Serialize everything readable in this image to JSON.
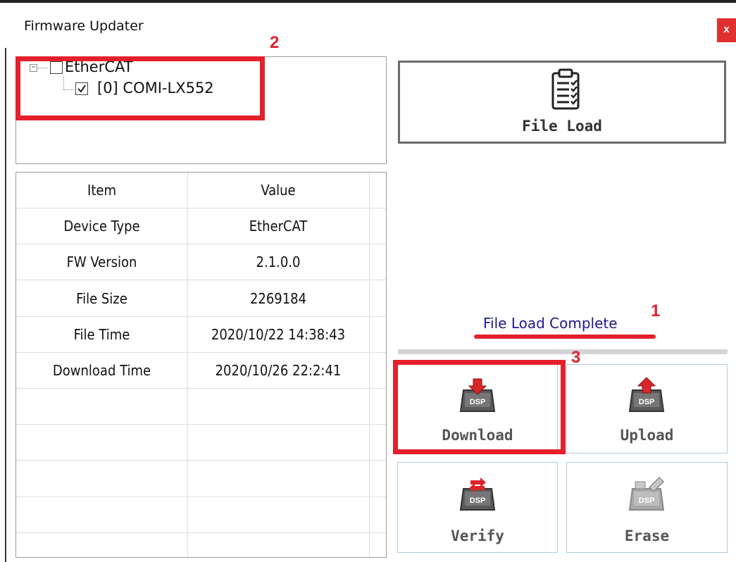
{
  "window": {
    "title": "Firmware Updater",
    "close_label": "x"
  },
  "tree": {
    "root": {
      "label": "EtherCAT",
      "checked": false,
      "expanded": true
    },
    "children": [
      {
        "label": "[0] COMI-LX552",
        "checked": true
      }
    ]
  },
  "table": {
    "headers": [
      "Item",
      "Value"
    ],
    "rows": [
      [
        "Device Type",
        "EtherCAT"
      ],
      [
        "FW Version",
        "2.1.0.0"
      ],
      [
        "File Size",
        "2269184"
      ],
      [
        "File Time",
        "2020/10/22 14:38:43"
      ],
      [
        "Download Time",
        "2020/10/26 22:2:41"
      ],
      [
        "",
        ""
      ],
      [
        "",
        ""
      ],
      [
        "",
        ""
      ],
      [
        "",
        ""
      ]
    ]
  },
  "buttons": {
    "file_load": "File Load",
    "download": "Download",
    "upload": "Upload",
    "verify": "Verify",
    "erase": "Erase",
    "dsp_badge": "DSP"
  },
  "status": {
    "text": "File Load Complete"
  },
  "annotations": {
    "a1": "1",
    "a2": "2",
    "a3": "3"
  },
  "icons": {
    "file_load": "clipboard-icon",
    "download": "dsp-download-icon",
    "upload": "dsp-upload-icon",
    "verify": "dsp-verify-icon",
    "erase": "dsp-erase-icon"
  },
  "colors": {
    "annotation_red": "#e4202c",
    "status_text": "#1a1a8c",
    "close_button": "#e03030"
  }
}
